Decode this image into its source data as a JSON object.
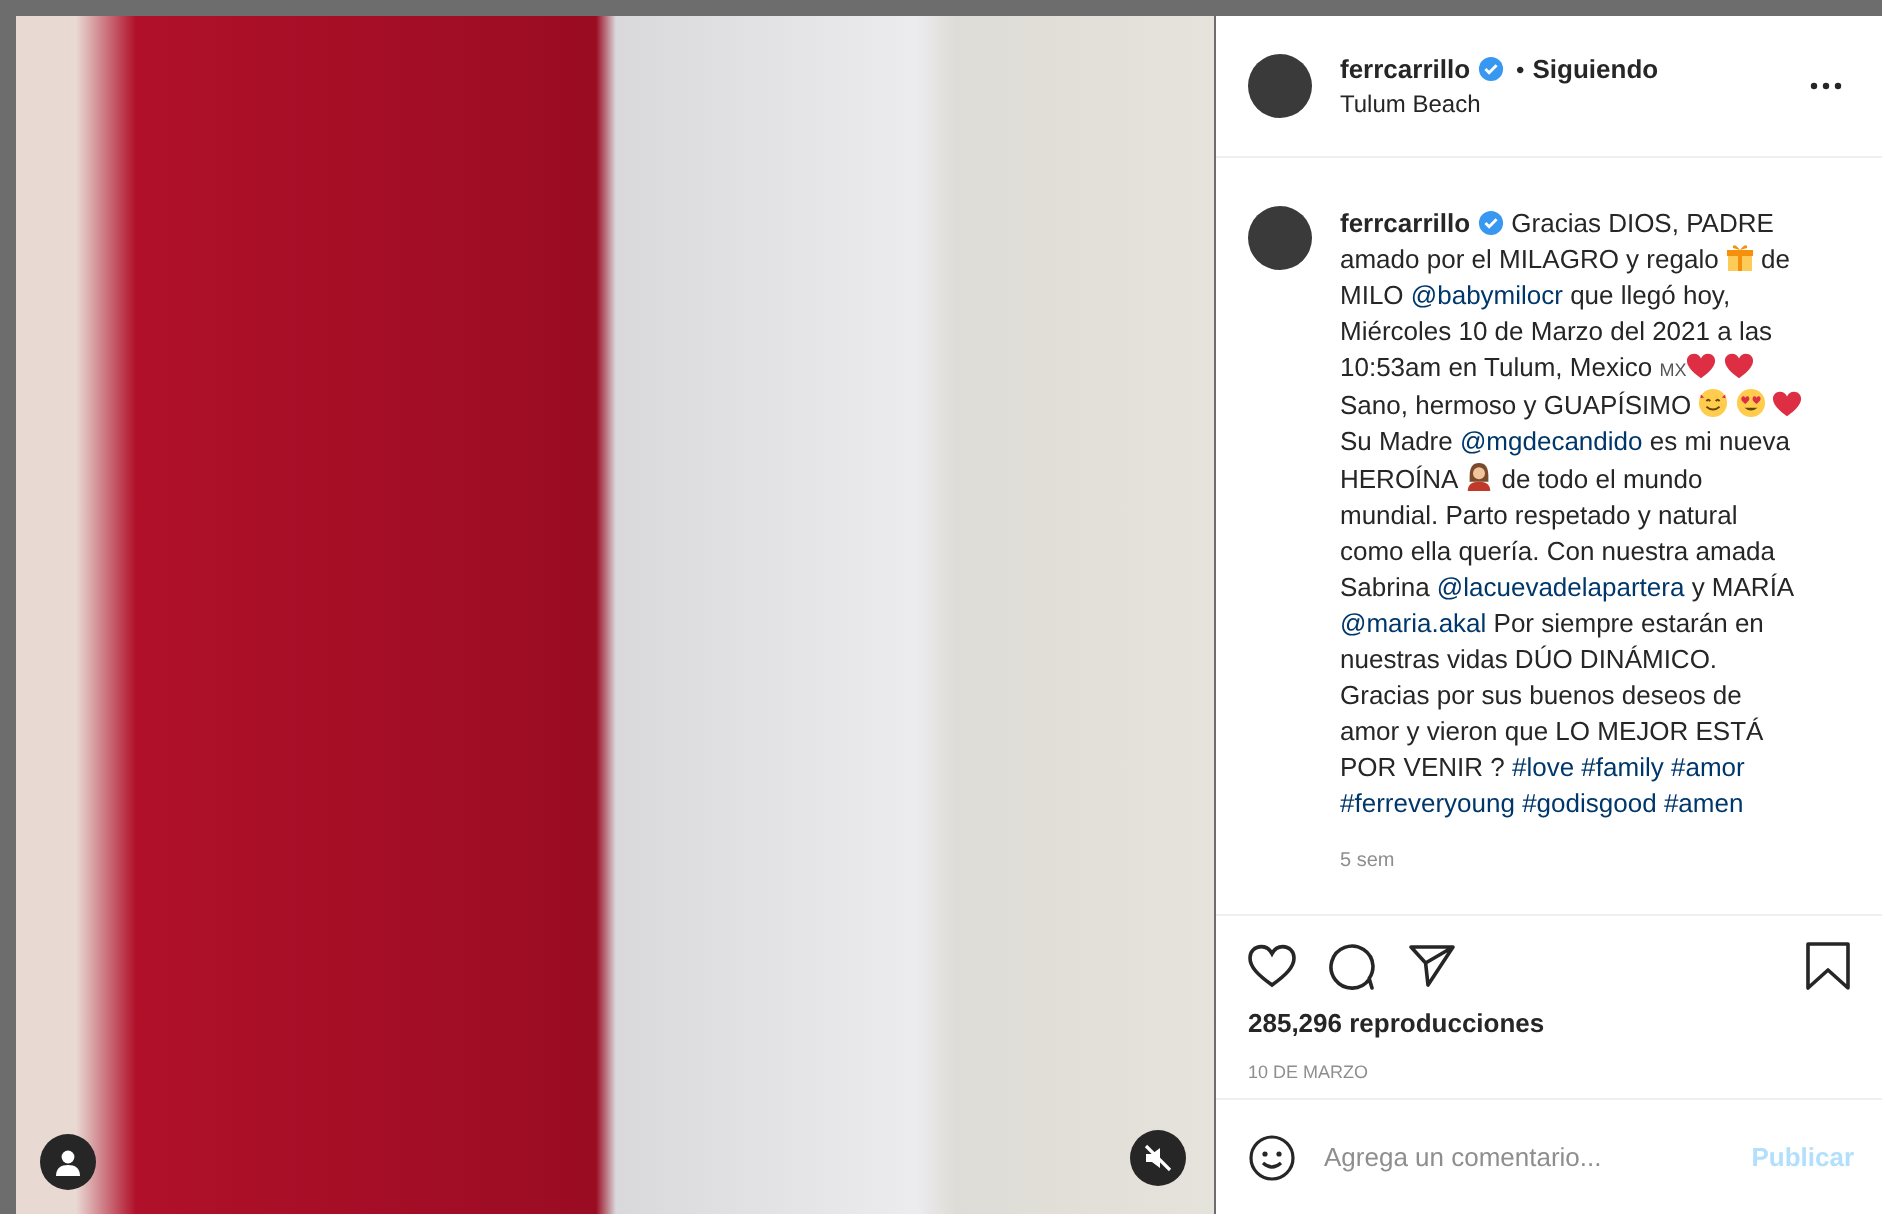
{
  "post": {
    "author": {
      "username": "ferrcarrillo",
      "verified": true,
      "separator": "•",
      "follow_status": "Siguiendo",
      "location": "Tulum Beach"
    },
    "caption": {
      "username": "ferrcarrillo",
      "verified": true,
      "segments": [
        {
          "kind": "text",
          "text": "Gracias DIOS, PADRE amado por el MILAGRO y regalo "
        },
        {
          "kind": "gift"
        },
        {
          "kind": "text",
          "text": " de MILO "
        },
        {
          "kind": "mention",
          "text": "@babymilocr"
        },
        {
          "kind": "text",
          "text": " que llegó hoy, Miércoles 10 de Marzo del 2021 a las 10:53am en Tulum, Mexico "
        },
        {
          "kind": "flag",
          "text": "MX"
        },
        {
          "kind": "heart"
        },
        {
          "kind": "space"
        },
        {
          "kind": "heart"
        },
        {
          "kind": "text",
          "text": " Sano, hermoso y GUAPÍSIMO "
        },
        {
          "kind": "smile"
        },
        {
          "kind": "space"
        },
        {
          "kind": "hearteyes"
        },
        {
          "kind": "space"
        },
        {
          "kind": "heart"
        },
        {
          "kind": "text",
          "text": "Su Madre "
        },
        {
          "kind": "mention",
          "text": "@mgdecandido"
        },
        {
          "kind": "text",
          "text": " es mi nueva HEROÍNA "
        },
        {
          "kind": "person"
        },
        {
          "kind": "text",
          "text": " de todo el mundo mundial. Parto respetado y natural como ella quería. Con nuestra amada Sabrina "
        },
        {
          "kind": "mention",
          "text": "@lacuevadelapartera"
        },
        {
          "kind": "text",
          "text": " y MARÍA "
        },
        {
          "kind": "mention",
          "text": "@maria.akal"
        },
        {
          "kind": "text",
          "text": " Por siempre estarán en nuestras vidas DÚO DINÁMICO. Gracias por sus buenos deseos de amor y vieron que LO MEJOR ESTÁ POR VENIR ? "
        },
        {
          "kind": "mention",
          "text": "#love"
        },
        {
          "kind": "space"
        },
        {
          "kind": "mention",
          "text": "#family"
        },
        {
          "kind": "space"
        },
        {
          "kind": "mention",
          "text": "#amor"
        },
        {
          "kind": "space"
        },
        {
          "kind": "mention",
          "text": "#ferreveryoung"
        },
        {
          "kind": "space"
        },
        {
          "kind": "mention",
          "text": "#godisgood"
        },
        {
          "kind": "space"
        },
        {
          "kind": "mention",
          "text": "#amen"
        }
      ],
      "age": "5 sem"
    },
    "views": "285,296 reproducciones",
    "date": "10 DE MARZO",
    "comment": {
      "placeholder": "Agrega un comentario...",
      "submit": "Publicar",
      "submit_disabled": true
    },
    "video": {
      "muted": true
    }
  }
}
